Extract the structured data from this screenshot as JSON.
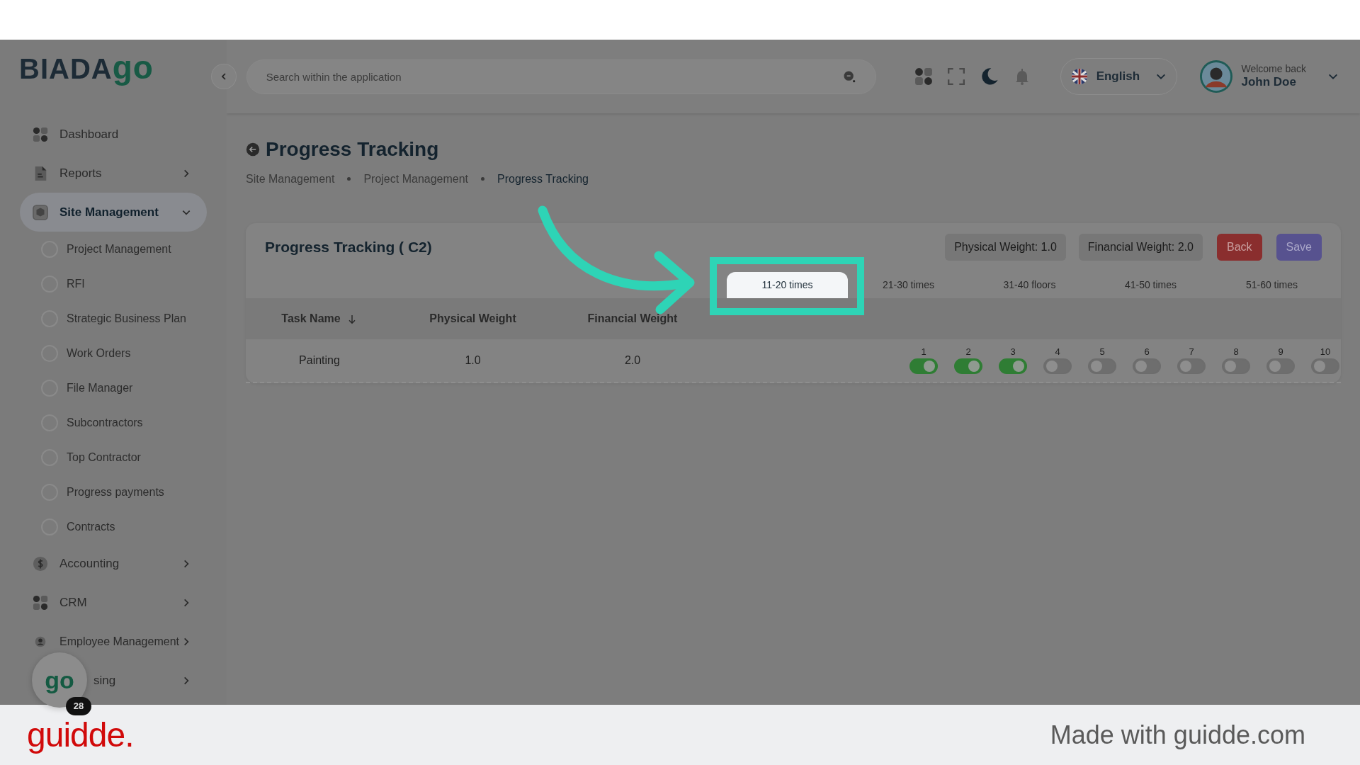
{
  "logo": {
    "text": "BIADA",
    "accent": "go"
  },
  "search": {
    "placeholder": "Search within the application"
  },
  "language": "English",
  "user": {
    "greeting": "Welcome back",
    "name": "John Doe"
  },
  "sidebar": {
    "items": [
      {
        "label": "Dashboard",
        "selected": false
      },
      {
        "label": "Reports",
        "selected": false,
        "expanded": false
      },
      {
        "label": "Site Management",
        "selected": true,
        "expanded": true,
        "children": [
          {
            "label": "Project Management"
          },
          {
            "label": "RFI"
          },
          {
            "label": "Strategic Business Plan"
          },
          {
            "label": "Work Orders"
          },
          {
            "label": "File Manager"
          },
          {
            "label": "Subcontractors"
          },
          {
            "label": "Top Contractor"
          },
          {
            "label": "Progress payments"
          },
          {
            "label": "Contracts"
          }
        ]
      },
      {
        "label": "Accounting",
        "selected": false,
        "expanded": false
      },
      {
        "label": "CRM",
        "selected": false,
        "expanded": false
      },
      {
        "label": "Employee Management",
        "selected": false,
        "expanded": false
      },
      {
        "label": "sing",
        "selected": false,
        "expanded": false
      }
    ]
  },
  "page": {
    "title": "Progress Tracking",
    "breadcrumb": [
      "Site Management",
      "Project Management",
      "Progress Tracking"
    ]
  },
  "card": {
    "title": "Progress Tracking ( C2)",
    "badges": [
      "Physical Weight: 1.0",
      "Financial Weight: 2.0"
    ],
    "buttons": [
      {
        "label": "Back",
        "kind": "danger"
      },
      {
        "label": "Save",
        "kind": "primary"
      }
    ],
    "tabs": [
      {
        "label": "11-20 times",
        "selected": true
      },
      {
        "label": "21-30 times",
        "selected": false
      },
      {
        "label": "31-40 floors",
        "selected": false
      },
      {
        "label": "41-50 times",
        "selected": false
      },
      {
        "label": "51-60 times",
        "selected": false
      }
    ],
    "columns": [
      "Task Name",
      "Physical Weight",
      "Financial Weight"
    ],
    "rows": [
      {
        "task": "Painting",
        "physical": "1.0",
        "financial": "2.0",
        "steps": [
          {
            "label": "1",
            "on": true
          },
          {
            "label": "2",
            "on": true
          },
          {
            "label": "3",
            "on": true
          },
          {
            "label": "4",
            "on": false
          },
          {
            "label": "5",
            "on": false
          },
          {
            "label": "6",
            "on": false
          },
          {
            "label": "7",
            "on": false
          },
          {
            "label": "8",
            "on": false
          },
          {
            "label": "9",
            "on": false
          },
          {
            "label": "10",
            "on": false
          }
        ]
      }
    ]
  },
  "chat": {
    "logo": "go",
    "badge": "28"
  },
  "footer": {
    "brand": "guidde.",
    "credit": "Made with guidde.com"
  }
}
